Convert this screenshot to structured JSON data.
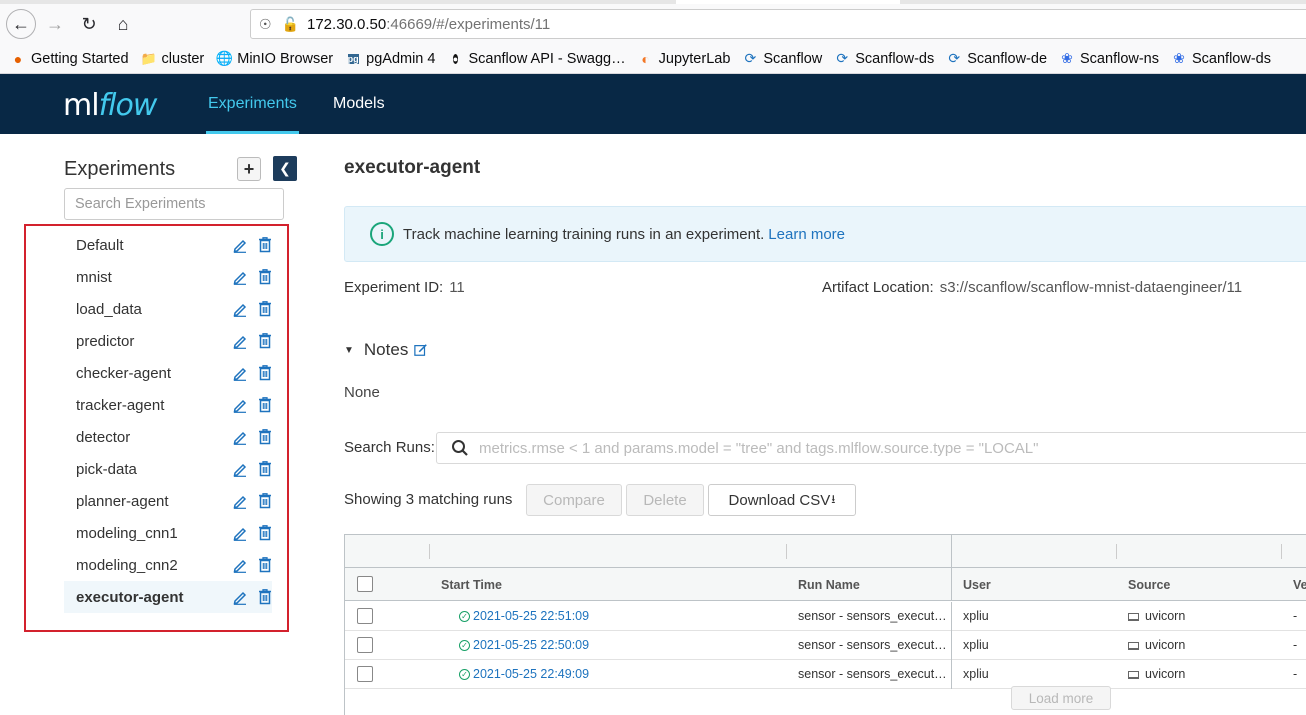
{
  "browser": {
    "url_host": "172.30.0.50",
    "url_rest": ":46669/#/experiments/11",
    "bookmarks": [
      {
        "label": "Getting Started",
        "icon": "firefox-icon"
      },
      {
        "label": "cluster",
        "icon": "folder-icon"
      },
      {
        "label": "MinIO Browser",
        "icon": "globe-icon"
      },
      {
        "label": "pgAdmin 4",
        "icon": "pgadmin-icon"
      },
      {
        "label": "Scanflow API - Swagg…",
        "icon": "swagger-icon"
      },
      {
        "label": "JupyterLab",
        "icon": "jupyter-icon"
      },
      {
        "label": "Scanflow",
        "icon": "scanflow-icon"
      },
      {
        "label": "Scanflow-ds",
        "icon": "scanflow-icon"
      },
      {
        "label": "Scanflow-de",
        "icon": "scanflow-icon"
      },
      {
        "label": "Scanflow-ns",
        "icon": "kubernetes-icon"
      },
      {
        "label": "Scanflow-ds",
        "icon": "kubernetes-icon"
      }
    ]
  },
  "header": {
    "logo_ml": "ml",
    "logo_flow": "flow",
    "nav": [
      "Experiments",
      "Models"
    ]
  },
  "sidebar": {
    "title": "Experiments",
    "add_label": "+",
    "search_placeholder": "Search Experiments",
    "experiments": [
      "Default",
      "mnist",
      "load_data",
      "predictor",
      "checker-agent",
      "tracker-agent",
      "detector",
      "pick-data",
      "planner-agent",
      "modeling_cnn1",
      "modeling_cnn2",
      "executor-agent"
    ],
    "active": "executor-agent"
  },
  "main": {
    "title": "executor-agent",
    "info_text": "Track machine learning training runs in an experiment.",
    "info_link": "Learn more",
    "experiment_id_label": "Experiment ID:",
    "experiment_id": "11",
    "artifact_label": "Artifact Location:",
    "artifact": "s3://scanflow/scanflow-mnist-dataengineer/11",
    "notes_label": "Notes",
    "notes_value": "None",
    "search_runs_label": "Search Runs:",
    "search_runs_placeholder": "metrics.rmse < 1 and params.model = \"tree\" and tags.mlflow.source.type = \"LOCAL\"",
    "showing": "Showing 3 matching runs",
    "compare": "Compare",
    "delete": "Delete",
    "download_csv": "Download CSV",
    "load_more": "Load more"
  },
  "table": {
    "headers": {
      "start_time": "Start Time",
      "run_name": "Run Name",
      "user": "User",
      "source": "Source",
      "version": "Ve"
    },
    "rows": [
      {
        "start_time": "2021-05-25 22:51:09",
        "run_name": "sensor - sensors_execut…",
        "user": "xpliu",
        "source": "uvicorn",
        "version": "-"
      },
      {
        "start_time": "2021-05-25 22:50:09",
        "run_name": "sensor - sensors_execut…",
        "user": "xpliu",
        "source": "uvicorn",
        "version": "-"
      },
      {
        "start_time": "2021-05-25 22:49:09",
        "run_name": "sensor - sensors_execut…",
        "user": "xpliu",
        "source": "uvicorn",
        "version": "-"
      }
    ]
  }
}
